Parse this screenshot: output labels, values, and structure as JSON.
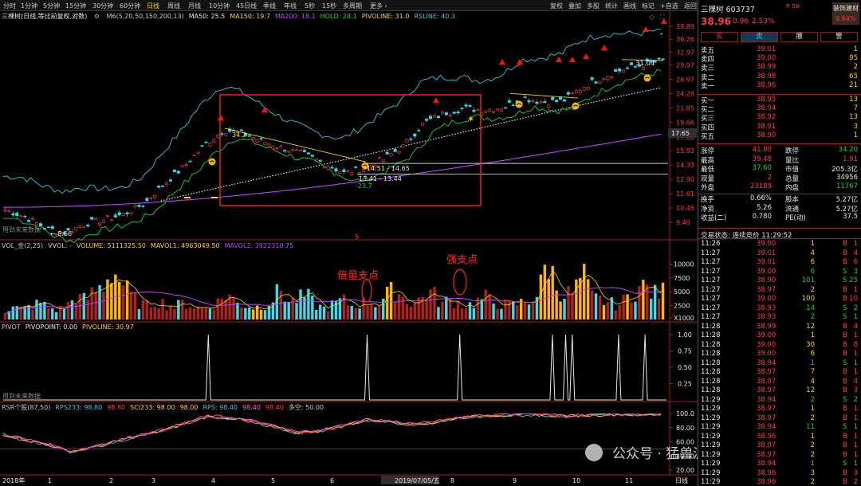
{
  "toolbar": {
    "left_items": [
      "分时",
      "1分钟",
      "5分钟",
      "15分钟",
      "30分钟",
      "60分钟",
      "日线",
      "周线",
      "月线",
      "10分钟",
      "45日线",
      "季线",
      "年线",
      "5秒",
      "15秒",
      "多周期",
      "更多 ›"
    ],
    "active": "日线",
    "right_items": [
      "复权",
      "叠加",
      "多股",
      "统计",
      "画线",
      "标记",
      "+自选",
      "返回"
    ]
  },
  "main_header": {
    "title": "三棵树(日线,等比前复权,对数)",
    "items": [
      {
        "text": "M6(5,20,50,150,200,13)",
        "color": "#c8c8c8"
      },
      {
        "text": "MA50: 25.5",
        "color": "#e6e6e6"
      },
      {
        "text": "MA150: 19.7",
        "color": "#ffd200"
      },
      {
        "text": "MA200: 18.1",
        "color": "#c040ff"
      },
      {
        "text": "HOLD: 28.1",
        "color": "#20d020"
      },
      {
        "text": "PIVOLINE: 31.0",
        "color": "#ffd200"
      },
      {
        "text": "RSLINE: 40.3",
        "color": "#30c8d8"
      }
    ]
  },
  "annotations": {
    "high_label": "34.2",
    "low_label": "-23.7",
    "range1": "14.51 - 14.65",
    "range2": "13.41 - 13.44",
    "last_high": "31.04",
    "early_low": "8.66",
    "future_data": "用到未来数据",
    "marker5": "5",
    "vol_callout1": "倍量支点",
    "vol_callout2": "强支点",
    "current_price": "17.65"
  },
  "price_axis": [
    "39.89",
    "36.26",
    "32.97",
    "29.97",
    "26.97",
    "24.28",
    "21.85",
    "19.66",
    "17.65",
    "15.93",
    "14.33",
    "12.90",
    "11.61",
    "10.45",
    "9.40"
  ],
  "vol_header": {
    "items": [
      {
        "text": "VOL_金(2,25)",
        "color": "#c8c8c8"
      },
      {
        "text": "VVOL: -",
        "color": "#c8c8c8"
      },
      {
        "text": "VOLUME: 5111325.50",
        "color": "#ffd200"
      },
      {
        "text": "MAVOL1: 4963049.50",
        "color": "#ffd200"
      },
      {
        "text": "MAVOL2: 3922310.75",
        "color": "#c040ff"
      }
    ]
  },
  "vol_axis": [
    "10000",
    "7500",
    "5000",
    "2500",
    "X1000"
  ],
  "pivot_header": {
    "items": [
      {
        "text": "PIVOT",
        "color": "#c8c8c8"
      },
      {
        "text": "PIVOPOINT: 0.00",
        "color": "#e6e6e6"
      },
      {
        "text": "PIVOLINE: 30.97",
        "color": "#ffd200"
      }
    ]
  },
  "pivot_axis": [
    "1.00",
    "0.75",
    "0.50",
    "0.25"
  ],
  "rsr_header": {
    "items": [
      {
        "text": "RSR个股(87,50)",
        "color": "#c8c8c8"
      },
      {
        "text": "RPS233: 98.80",
        "color": "#30c8d8"
      },
      {
        "text": "98.80",
        "color": "#ff3b3b"
      },
      {
        "text": "SCI233: 98.00",
        "color": "#ffd200"
      },
      {
        "text": "98.00",
        "color": "#ffd200"
      },
      {
        "text": "RPS: 98.40",
        "color": "#30c8d8"
      },
      {
        "text": "98.40",
        "color": "#ff5ad8"
      },
      {
        "text": "98.40",
        "color": "#ff3b3b"
      },
      {
        "text": "多空: 50.00",
        "color": "#c8c8c8"
      }
    ]
  },
  "rsr_axis": [
    "100.0",
    "80.00",
    "60.00",
    "40.00",
    "20.00"
  ],
  "x_axis": {
    "labels": [
      "2018年",
      "1",
      "2",
      "3",
      "4",
      "5",
      "6",
      "7",
      "2019/07/05/五",
      "8",
      "9",
      "10",
      "11"
    ],
    "end_label": "日线"
  },
  "watermark": "公众号 · 猛兽派选股",
  "right_panel": {
    "stock_name": "三棵树 603737",
    "stock_tag": "R 5⊞",
    "industry": "装饰建材",
    "industry_pct": "0.64%",
    "price": "38.96",
    "change": "0.96",
    "change_pct": "2.53%",
    "trade_buttons": [
      "买",
      "卖",
      "撤",
      "警"
    ],
    "asks": [
      {
        "label": "卖五",
        "price": "39.01",
        "vol": "1"
      },
      {
        "label": "卖四",
        "price": "39.00",
        "vol": "95"
      },
      {
        "label": "卖三",
        "price": "38.99",
        "vol": "2"
      },
      {
        "label": "卖二",
        "price": "38.98",
        "vol": "65"
      },
      {
        "label": "卖一",
        "price": "38.96",
        "vol": "21"
      }
    ],
    "bids": [
      {
        "label": "买一",
        "price": "38.95",
        "vol": "13"
      },
      {
        "label": "买二",
        "price": "38.94",
        "vol": "7"
      },
      {
        "label": "买三",
        "price": "38.92",
        "vol": "13"
      },
      {
        "label": "买四",
        "price": "38.91",
        "vol": "3"
      },
      {
        "label": "买五",
        "price": "38.90",
        "vol": "1"
      }
    ],
    "stats": [
      {
        "l1": "涨停",
        "v1": "41.80",
        "c1": "red",
        "l2": "跌停",
        "v2": "34.20",
        "c2": "grn"
      },
      {
        "l1": "最高",
        "v1": "39.48",
        "c1": "red",
        "l2": "量比",
        "v2": "1.91",
        "c2": "red"
      },
      {
        "l1": "最低",
        "v1": "37.60",
        "c1": "grn",
        "l2": "市值",
        "v2": "205.3亿",
        "c2": "wht"
      },
      {
        "l1": "现量",
        "v1": "2",
        "c1": "red",
        "l2": "总量",
        "v2": "34956",
        "c2": "wht"
      },
      {
        "l1": "外盘",
        "v1": "23189",
        "c1": "red",
        "l2": "内盘",
        "v2": "11767",
        "c2": "grn"
      },
      {
        "l1": "换手",
        "v1": "0.66%",
        "c1": "wht",
        "l2": "股本",
        "v2": "5.27亿",
        "c2": "wht"
      },
      {
        "l1": "净资",
        "v1": "5.26",
        "c1": "wht",
        "l2": "流通",
        "v2": "5.27亿",
        "c2": "wht"
      },
      {
        "l1": "收益(二)",
        "v1": "0.780",
        "c1": "wht",
        "l2": "PE(动)",
        "v2": "37.5",
        "c2": "wht"
      }
    ],
    "trade_status": "交易状态: 连续竞价 11:29:52",
    "ticks": [
      {
        "t": "11:26",
        "p": "39.00",
        "v": "1",
        "s": "B",
        "n": "1"
      },
      {
        "t": "11:27",
        "p": "39.01",
        "v": "4",
        "s": "B",
        "n": "4"
      },
      {
        "t": "11:27",
        "p": "39.01",
        "v": "6",
        "s": "B",
        "n": "6"
      },
      {
        "t": "11:27",
        "p": "39.00",
        "v": "6",
        "s": "S",
        "n": "3"
      },
      {
        "t": "11:27",
        "p": "38.90",
        "v": "101",
        "s": "S",
        "n": "25"
      },
      {
        "t": "11:27",
        "p": "38.97",
        "v": "2",
        "s": "B",
        "n": "1"
      },
      {
        "t": "11:27",
        "p": "39.00",
        "v": "100",
        "s": "B",
        "n": "10"
      },
      {
        "t": "11:27",
        "p": "38.93",
        "v": "14",
        "s": "S",
        "n": "2"
      },
      {
        "t": "11:27",
        "p": "38.93",
        "v": "2",
        "s": "S",
        "n": "1"
      },
      {
        "t": "11:28",
        "p": "38.99",
        "v": "12",
        "s": "B",
        "n": "4"
      },
      {
        "t": "11:28",
        "p": "39.00",
        "v": "1",
        "s": "B",
        "n": "1"
      },
      {
        "t": "11:28",
        "p": "39.00",
        "v": "30",
        "s": "B",
        "n": "8"
      },
      {
        "t": "11:28",
        "p": "39.00",
        "v": "6",
        "s": "B",
        "n": "1"
      },
      {
        "t": "11:28",
        "p": "38.94",
        "v": "1",
        "s": "S",
        "n": "1"
      },
      {
        "t": "11:28",
        "p": "38.97",
        "v": "7",
        "s": "B",
        "n": "1"
      },
      {
        "t": "11:28",
        "p": "38.97",
        "v": "4",
        "s": "B",
        "n": "4"
      },
      {
        "t": "11:28",
        "p": "38.97",
        "v": "12",
        "s": "B",
        "n": "3"
      },
      {
        "t": "11:29",
        "p": "38.94",
        "v": "2",
        "s": "S",
        "n": "2"
      },
      {
        "t": "11:29",
        "p": "38.97",
        "v": "1",
        "s": "B",
        "n": "1"
      },
      {
        "t": "11:29",
        "p": "38.97",
        "v": "2",
        "s": "B",
        "n": "1"
      },
      {
        "t": "11:29",
        "p": "38.94",
        "v": "11",
        "s": "S",
        "n": "1"
      },
      {
        "t": "11:29",
        "p": "38.96",
        "v": "1",
        "s": "B",
        "n": "1"
      },
      {
        "t": "11:29",
        "p": "38.97",
        "v": "2",
        "s": "B",
        "n": "1"
      },
      {
        "t": "11:29",
        "p": "38.97",
        "v": "2",
        "s": "B",
        "n": "1"
      },
      {
        "t": "11:29",
        "p": "38.94",
        "v": "1",
        "s": "S",
        "n": "1"
      },
      {
        "t": "11:29",
        "p": "38.96",
        "v": "3",
        "s": "B",
        "n": "3"
      },
      {
        "t": "11:29",
        "p": "38.96",
        "v": "2",
        "s": "B",
        "n": "2"
      }
    ]
  },
  "chart_data": [
    {
      "type": "candlestick",
      "title": "三棵树(日线,等比前复权,对数)",
      "x_range": [
        "2018-01",
        "2019-11"
      ],
      "y_scale": "log",
      "ylim": [
        9.4,
        39.89
      ],
      "approx_close_path": [
        10.3,
        9.8,
        9.0,
        8.7,
        9.3,
        9.6,
        10.0,
        10.8,
        12.5,
        14.2,
        16.6,
        18.6,
        18.0,
        17.0,
        16.2,
        15.5,
        14.5,
        13.5,
        14.0,
        15.0,
        16.5,
        19.5,
        21.0,
        21.8,
        21.5,
        22.0,
        23.5,
        22.8,
        23.0,
        25.5,
        27.5,
        29.0,
        30.0,
        31.0
      ],
      "series": [
        {
          "name": "MA50",
          "last": 25.5
        },
        {
          "name": "MA150",
          "last": 19.7
        },
        {
          "name": "MA200",
          "last": 18.1
        },
        {
          "name": "HOLD",
          "last": 28.1
        },
        {
          "name": "PIVOLINE",
          "last": 31.0
        },
        {
          "name": "RSLINE",
          "last": 40.3
        }
      ],
      "horizontal_levels": [
        14.51,
        13.41
      ]
    },
    {
      "type": "bar",
      "title": "VOL_金(2,25)",
      "ylim": [
        0,
        12500
      ],
      "values": [
        1500,
        2200,
        1800,
        2500,
        3000,
        2000,
        1700,
        2600,
        4000,
        3500,
        5000,
        6000,
        9000,
        7000,
        4500,
        3000,
        2500,
        3500,
        2800,
        2200,
        3000,
        2500,
        2000,
        2400,
        3200,
        4800,
        3000,
        2600,
        2200,
        2500,
        3500,
        5500,
        3000,
        3800,
        4200,
        2500,
        2000,
        2800,
        3500,
        2400,
        3000,
        3200,
        2800,
        4500,
        5500,
        3500,
        3000,
        4000,
        5000,
        2800,
        3500,
        3000,
        2500,
        3200,
        4000,
        3000,
        2800,
        2500,
        3000,
        3500,
        4500,
        11000,
        6000,
        4500,
        5000,
        8000,
        4000,
        3500,
        3000,
        2500,
        4000,
        5500,
        6000,
        4500,
        5000
      ],
      "series": [
        {
          "name": "VOLUME",
          "last": 5111325.5
        },
        {
          "name": "MAVOL1",
          "last": 4963049.5
        },
        {
          "name": "MAVOL2",
          "last": 3922310.75
        }
      ]
    },
    {
      "type": "line",
      "title": "PIVOT",
      "ylim": [
        0,
        1.0
      ],
      "spike_positions": [
        0.31,
        0.55,
        0.69,
        0.83,
        0.85,
        0.86,
        0.93,
        0.97
      ],
      "series": [
        {
          "name": "PIVOPOINT",
          "last": 0.0
        },
        {
          "name": "PIVOLINE",
          "last": 30.97
        }
      ]
    },
    {
      "type": "line",
      "title": "RSR个股(87,50)",
      "ylim": [
        20,
        100
      ],
      "approx_path": [
        70,
        62,
        55,
        45,
        52,
        60,
        68,
        75,
        85,
        95,
        93,
        88,
        80,
        72,
        75,
        82,
        90,
        88,
        84,
        86,
        93,
        96,
        97,
        98,
        97,
        96,
        97,
        98,
        97,
        98
      ],
      "series": [
        {
          "name": "RPS233",
          "last": 98.8
        },
        {
          "name": "SCI233",
          "last": 98.0
        },
        {
          "name": "RPS",
          "last": 98.4
        },
        {
          "name": "多空",
          "last": 50.0
        }
      ]
    }
  ]
}
